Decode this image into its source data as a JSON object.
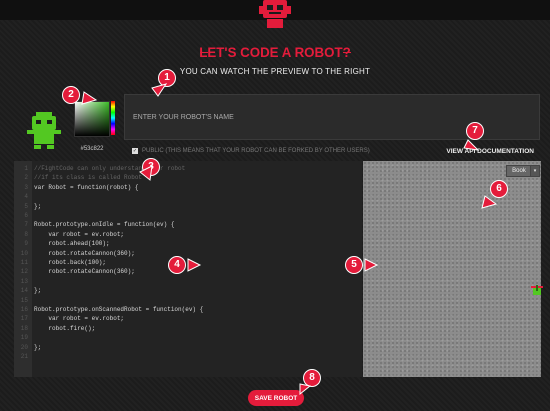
{
  "header": {
    "title": "LET'S CODE A ROBOT?",
    "subtitle": "YOU CAN WATCH THE PREVIEW TO THE RIGHT"
  },
  "robot": {
    "color_hex": "#53c822",
    "name_placeholder": "ENTER YOUR ROBOT'S NAME",
    "public_label": "PUBLIC (THIS MEANS THAT YOUR ROBOT CAN BE FORKED BY OTHER USERS)",
    "public_checked": true
  },
  "api_link_label": "VIEW API DOCUMENTATION",
  "editor": {
    "lines": [
      {
        "n": "1",
        "text": "//FightCode can only understand your robot",
        "type": "comment"
      },
      {
        "n": "2",
        "text": "//if its class is called Robot",
        "type": "comment"
      },
      {
        "n": "3",
        "text": "var Robot = function(robot) {",
        "type": "code"
      },
      {
        "n": "4",
        "text": "",
        "type": "code"
      },
      {
        "n": "5",
        "text": "};",
        "type": "code"
      },
      {
        "n": "6",
        "text": "",
        "type": "code"
      },
      {
        "n": "7",
        "text": "Robot.prototype.onIdle = function(ev) {",
        "type": "code"
      },
      {
        "n": "8",
        "text": "    var robot = ev.robot;",
        "type": "code"
      },
      {
        "n": "9",
        "text": "    robot.ahead(100);",
        "type": "code"
      },
      {
        "n": "10",
        "text": "    robot.rotateCannon(360);",
        "type": "code"
      },
      {
        "n": "11",
        "text": "    robot.back(100);",
        "type": "code"
      },
      {
        "n": "12",
        "text": "    robot.rotateCannon(360);",
        "type": "code"
      },
      {
        "n": "13",
        "text": "",
        "type": "code"
      },
      {
        "n": "14",
        "text": "};",
        "type": "code"
      },
      {
        "n": "15",
        "text": "",
        "type": "code"
      },
      {
        "n": "16",
        "text": "Robot.prototype.onScannedRobot = function(ev) {",
        "type": "code"
      },
      {
        "n": "17",
        "text": "    var robot = ev.robot;",
        "type": "code"
      },
      {
        "n": "18",
        "text": "    robot.fire();",
        "type": "code"
      },
      {
        "n": "19",
        "text": "",
        "type": "code"
      },
      {
        "n": "20",
        "text": "};",
        "type": "code"
      },
      {
        "n": "21",
        "text": "",
        "type": "code"
      }
    ]
  },
  "preview": {
    "speed_label": "Book",
    "dropdown_glyph": "▾"
  },
  "save_label": "SAVE ROBOT",
  "callouts": [
    "1",
    "2",
    "3",
    "4",
    "5",
    "6",
    "7",
    "8"
  ],
  "colors": {
    "accent": "#e41c3b",
    "robot_green": "#53c822",
    "background": "#1c1c1c"
  }
}
